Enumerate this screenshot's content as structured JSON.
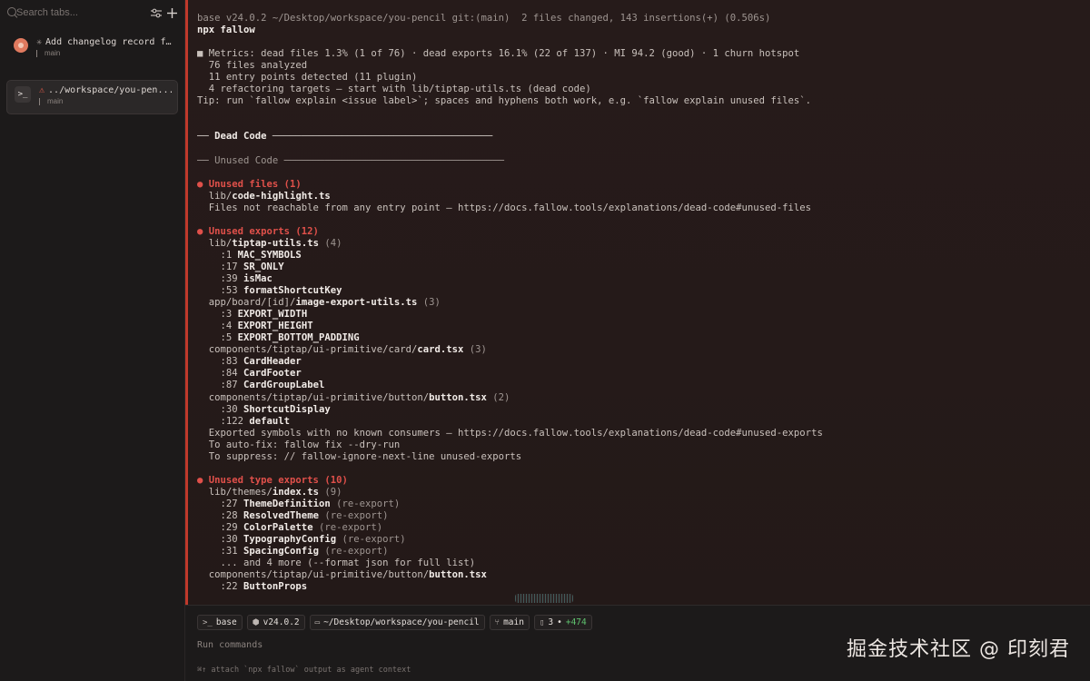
{
  "sidebar": {
    "search_placeholder": "Search tabs...",
    "tabs": [
      {
        "glyph": "✳",
        "title": "Add changelog record for",
        "branch": "main",
        "active": false
      },
      {
        "glyph": "⚠",
        "title": "../workspace/you-pen...",
        "branch": "main",
        "active": true
      }
    ]
  },
  "terminal": {
    "lines": [
      [
        {
          "t": "base v24.0.2 ~/Desktop/workspace/you-pencil git:(main)  2 files changed, 143 insertions(+) (0.506s)",
          "c": "dim"
        }
      ],
      [
        {
          "t": "npx fallow",
          "c": "cmd"
        }
      ],
      [
        {
          "t": ""
        }
      ],
      [
        {
          "t": "■ Metrics: dead files 1.3% (1 of 76) · dead exports 16.1% (22 of 137) · MI 94.2 (good) · 1 churn hotspot",
          "c": ""
        }
      ],
      [
        {
          "t": "  76 files analyzed",
          "c": ""
        }
      ],
      [
        {
          "t": "  11 entry points detected (11 plugin)",
          "c": ""
        }
      ],
      [
        {
          "t": "  4 refactoring targets — start with lib/tiptap-utils.ts (dead code)",
          "c": ""
        }
      ],
      [
        {
          "t": "Tip: run `fallow explain <issue label>`; spaces and hyphens both work, e.g. `fallow explain unused files`.",
          "c": ""
        }
      ],
      [
        {
          "t": ""
        }
      ],
      [
        {
          "t": ""
        }
      ],
      [
        {
          "t": "── ",
          "c": "rule"
        },
        {
          "t": "Dead Code",
          "c": "bold"
        },
        {
          "t": " ──────────────────────────────────────",
          "c": "rule"
        }
      ],
      [
        {
          "t": ""
        }
      ],
      [
        {
          "t": "── Unused Code ──────────────────────────────────────",
          "c": "dim"
        }
      ],
      [
        {
          "t": ""
        }
      ],
      [
        {
          "t": "● Unused files (1)",
          "c": "red"
        }
      ],
      [
        {
          "t": "  lib/",
          "c": ""
        },
        {
          "t": "code-highlight.ts",
          "c": "bold"
        }
      ],
      [
        {
          "t": "  Files not reachable from any entry point — https://docs.fallow.tools/explanations/dead-code#unused-files",
          "c": ""
        }
      ],
      [
        {
          "t": ""
        }
      ],
      [
        {
          "t": "● Unused exports (12)",
          "c": "red"
        }
      ],
      [
        {
          "t": "  lib/",
          "c": ""
        },
        {
          "t": "tiptap-utils.ts",
          "c": "bold"
        },
        {
          "t": " (4)",
          "c": "dim"
        }
      ],
      [
        {
          "t": "    :1 ",
          "c": ""
        },
        {
          "t": "MAC_SYMBOLS",
          "c": "bold"
        }
      ],
      [
        {
          "t": "    :17 ",
          "c": ""
        },
        {
          "t": "SR_ONLY",
          "c": "bold"
        }
      ],
      [
        {
          "t": "    :39 ",
          "c": ""
        },
        {
          "t": "isMac",
          "c": "bold"
        }
      ],
      [
        {
          "t": "    :53 ",
          "c": ""
        },
        {
          "t": "formatShortcutKey",
          "c": "bold"
        }
      ],
      [
        {
          "t": "  app/board/[id]/",
          "c": ""
        },
        {
          "t": "image-export-utils.ts",
          "c": "bold"
        },
        {
          "t": " (3)",
          "c": "dim"
        }
      ],
      [
        {
          "t": "    :3 ",
          "c": ""
        },
        {
          "t": "EXPORT_WIDTH",
          "c": "bold"
        }
      ],
      [
        {
          "t": "    :4 ",
          "c": ""
        },
        {
          "t": "EXPORT_HEIGHT",
          "c": "bold"
        }
      ],
      [
        {
          "t": "    :5 ",
          "c": ""
        },
        {
          "t": "EXPORT_BOTTOM_PADDING",
          "c": "bold"
        }
      ],
      [
        {
          "t": "  components/tiptap/ui-primitive/card/",
          "c": ""
        },
        {
          "t": "card.tsx",
          "c": "bold"
        },
        {
          "t": " (3)",
          "c": "dim"
        }
      ],
      [
        {
          "t": "    :83 ",
          "c": ""
        },
        {
          "t": "CardHeader",
          "c": "bold"
        }
      ],
      [
        {
          "t": "    :84 ",
          "c": ""
        },
        {
          "t": "CardFooter",
          "c": "bold"
        }
      ],
      [
        {
          "t": "    :87 ",
          "c": ""
        },
        {
          "t": "CardGroupLabel",
          "c": "bold"
        }
      ],
      [
        {
          "t": "  components/tiptap/ui-primitive/button/",
          "c": ""
        },
        {
          "t": "button.tsx",
          "c": "bold"
        },
        {
          "t": " (2)",
          "c": "dim"
        }
      ],
      [
        {
          "t": "    :30 ",
          "c": ""
        },
        {
          "t": "ShortcutDisplay",
          "c": "bold"
        }
      ],
      [
        {
          "t": "    :122 ",
          "c": ""
        },
        {
          "t": "default",
          "c": "bold"
        }
      ],
      [
        {
          "t": "  Exported symbols with no known consumers — https://docs.fallow.tools/explanations/dead-code#unused-exports",
          "c": ""
        }
      ],
      [
        {
          "t": "  To auto-fix: fallow fix --dry-run",
          "c": ""
        }
      ],
      [
        {
          "t": "  To suppress: // fallow-ignore-next-line unused-exports",
          "c": ""
        }
      ],
      [
        {
          "t": ""
        }
      ],
      [
        {
          "t": "● Unused type exports (10)",
          "c": "red"
        }
      ],
      [
        {
          "t": "  lib/themes/",
          "c": ""
        },
        {
          "t": "index.ts",
          "c": "bold"
        },
        {
          "t": " (9)",
          "c": "dim"
        }
      ],
      [
        {
          "t": "    :27 ",
          "c": ""
        },
        {
          "t": "ThemeDefinition",
          "c": "bold"
        },
        {
          "t": " (re-export)",
          "c": "dim"
        }
      ],
      [
        {
          "t": "    :28 ",
          "c": ""
        },
        {
          "t": "ResolvedTheme",
          "c": "bold"
        },
        {
          "t": " (re-export)",
          "c": "dim"
        }
      ],
      [
        {
          "t": "    :29 ",
          "c": ""
        },
        {
          "t": "ColorPalette",
          "c": "bold"
        },
        {
          "t": " (re-export)",
          "c": "dim"
        }
      ],
      [
        {
          "t": "    :30 ",
          "c": ""
        },
        {
          "t": "TypographyConfig",
          "c": "bold"
        },
        {
          "t": " (re-export)",
          "c": "dim"
        }
      ],
      [
        {
          "t": "    :31 ",
          "c": ""
        },
        {
          "t": "SpacingConfig",
          "c": "bold"
        },
        {
          "t": " (re-export)",
          "c": "dim"
        }
      ],
      [
        {
          "t": "    ... and 4 more (--format json for full list)",
          "c": ""
        }
      ],
      [
        {
          "t": "  components/tiptap/ui-primitive/button/",
          "c": ""
        },
        {
          "t": "button.tsx",
          "c": "bold"
        }
      ],
      [
        {
          "t": "    :22 ",
          "c": ""
        },
        {
          "t": "ButtonProps",
          "c": "bold"
        }
      ]
    ]
  },
  "statusbar": {
    "env": "base",
    "node": "v24.0.2",
    "path": "~/Desktop/workspace/you-pencil",
    "branch": "main",
    "changes": "3",
    "separator": "•",
    "insertions": "+474"
  },
  "input": {
    "placeholder": "Run commands"
  },
  "hint": "⌘↑ attach `npx fallow` output as agent context",
  "watermark": "掘金技术社区 @ 印刻君"
}
